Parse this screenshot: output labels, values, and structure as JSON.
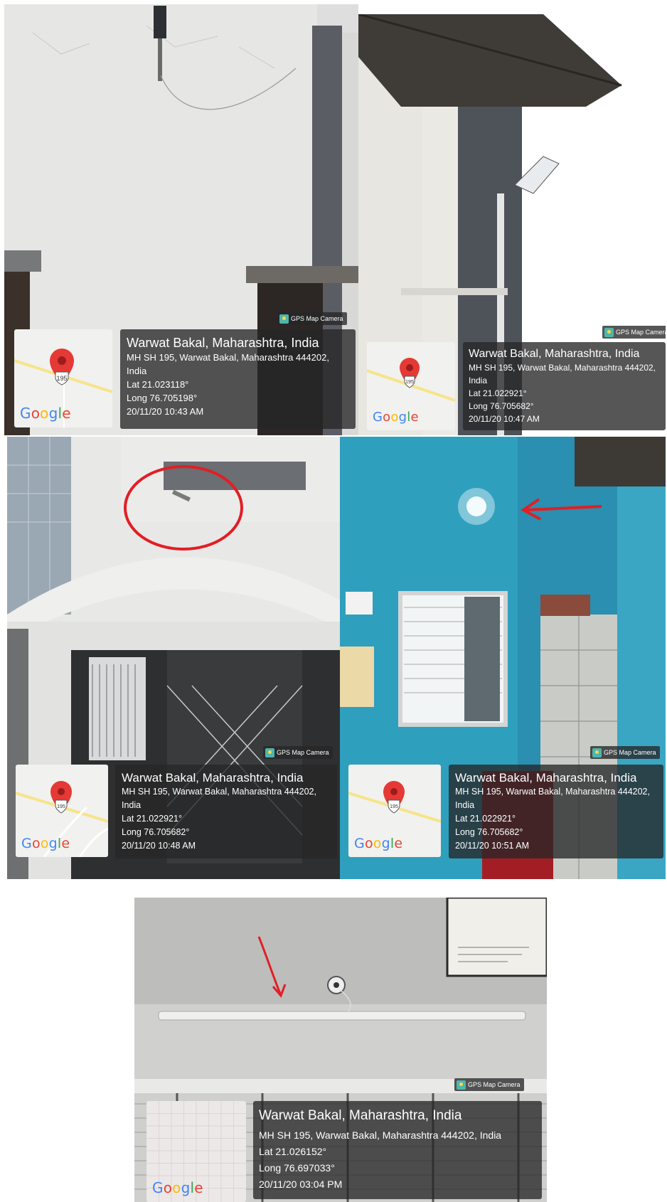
{
  "brand": {
    "google_letters": [
      {
        "char": "G",
        "color": "#4285F4"
      },
      {
        "char": "o",
        "color": "#EA4335"
      },
      {
        "char": "o",
        "color": "#FBBC05"
      },
      {
        "char": "g",
        "color": "#4285F4"
      },
      {
        "char": "l",
        "color": "#34A853"
      },
      {
        "char": "e",
        "color": "#EA4335"
      }
    ],
    "pin_color": "#E53935",
    "app_badge": "GPS Map Camera",
    "map_icon": "map-pin-icon"
  },
  "photos": [
    {
      "title": "Warwat Bakal, Maharashtra, India",
      "address_lines": [
        "MH SH 195, Warwat Bakal, Maharashtra 444202,",
        "India"
      ],
      "lat": "Lat 21.023118°",
      "long": "Long 76.705198°",
      "datetime": "20/11/20 10:43 AM",
      "road_shield": "195"
    },
    {
      "title": "Warwat Bakal, Maharashtra, India",
      "address_lines": [
        "MH SH 195, Warwat Bakal, Maharashtra 444202,",
        "India"
      ],
      "lat": "Lat 21.022921°",
      "long": "Long 76.705682°",
      "datetime": "20/11/20 10:47 AM",
      "road_shield": "195"
    },
    {
      "title": "Warwat Bakal, Maharashtra, India",
      "address_lines": [
        "MH SH 195, Warwat Bakal, Maharashtra 444202,",
        "India"
      ],
      "lat": "Lat 21.022921°",
      "long": "Long 76.705682°",
      "datetime": "20/11/20 10:48 AM",
      "road_shield": "195"
    },
    {
      "title": "Warwat Bakal, Maharashtra, India",
      "address_lines": [
        "MH SH 195, Warwat Bakal, Maharashtra 444202,",
        "India"
      ],
      "lat": "Lat 21.022921°",
      "long": "Long 76.705682°",
      "datetime": "20/11/20 10:51 AM",
      "road_shield": "195"
    },
    {
      "title": "Warwat Bakal, Maharashtra, India",
      "address_lines": [
        "MH SH 195, Warwat Bakal, Maharashtra 444202, India"
      ],
      "lat": "Lat 21.026152°",
      "long": "Long 76.697033°",
      "datetime": "20/11/20 03:04 PM",
      "road_shield": ""
    }
  ]
}
